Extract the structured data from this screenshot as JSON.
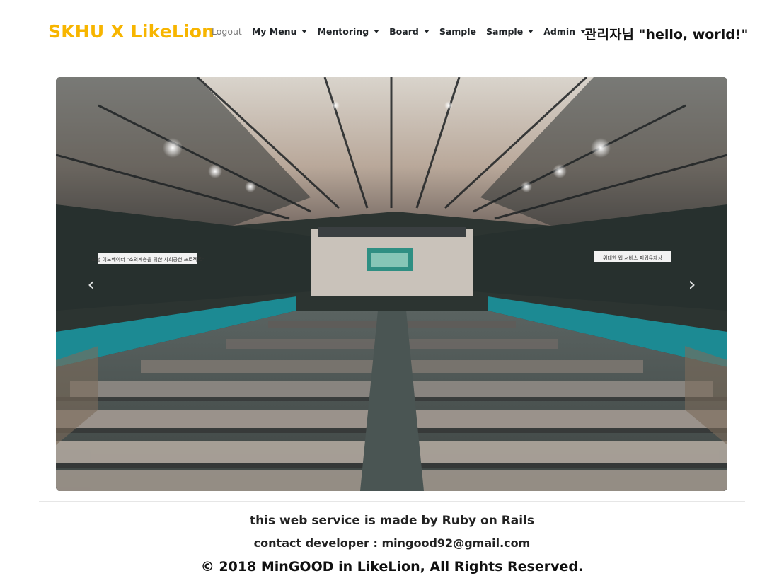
{
  "brand": "SKHU X LikeLion",
  "nav": {
    "logout": "Logout",
    "my_menu": "My Menu",
    "mentoring": "Mentoring",
    "board": "Board",
    "sample": "Sample",
    "sample_dropdown": "Sample",
    "admin": "Admin"
  },
  "greeting": "관리자님 \"hello, world!\"",
  "carousel": {
    "prev_icon": "chevron-left",
    "next_icon": "chevron-right",
    "banner_left": "소셜 이노베이터 \"소외계층을 위한 사회공헌 프로젝트\"",
    "banner_right": "위대한 웹 서비스 피워유재상"
  },
  "footer": {
    "line1": "this web service is made by Ruby on Rails",
    "line2": "contact developer : mingood92@gmail.com",
    "line3": "© 2018 MinGOOD in LikeLion, All Rights Reserved."
  },
  "colors": {
    "brand": "#f7b500",
    "text": "#212529",
    "muted": "#7a7a7a"
  }
}
